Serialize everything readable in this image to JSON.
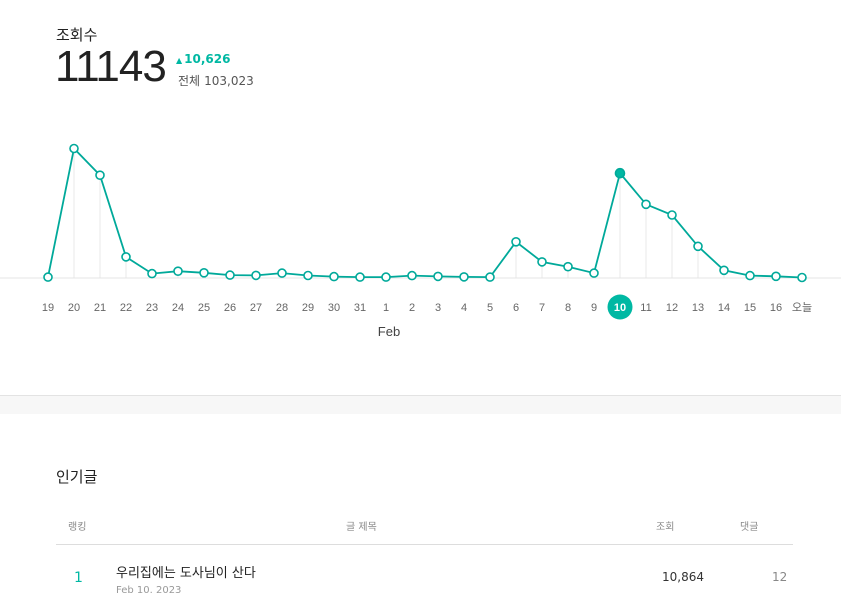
{
  "stats": {
    "label": "조회수",
    "value": "11143",
    "delta_arrow": "▲",
    "delta": "10,626",
    "total_label": "전체",
    "total": "103,023"
  },
  "chart_data": {
    "type": "line",
    "x": [
      "19",
      "20",
      "21",
      "22",
      "23",
      "24",
      "25",
      "26",
      "27",
      "28",
      "29",
      "30",
      "31",
      "1",
      "2",
      "3",
      "4",
      "5",
      "6",
      "7",
      "8",
      "9",
      "10",
      "11",
      "12",
      "13",
      "14",
      "15",
      "16",
      "오늘"
    ],
    "values": [
      95,
      12950,
      10280,
      2108,
      443,
      679,
      521,
      288,
      259,
      493,
      251,
      144,
      95,
      94,
      245,
      160,
      110,
      95,
      3617,
      1611,
      1126,
      493,
      10480,
      7367,
      6298,
      3166,
      765,
      244,
      170,
      51
    ],
    "highlight_label": "10",
    "month_label": "Feb",
    "ylim": [
      0,
      14000
    ],
    "grid": false,
    "accent_color": "#00b8a3"
  },
  "popular": {
    "title": "인기글",
    "headers": {
      "rank": "랭킹",
      "title": "글 제목",
      "views": "조회",
      "comments": "댓글"
    },
    "rows": [
      {
        "rank": "1",
        "title": "우리집에는 도사님이 산다",
        "date": "Feb 10. 2023",
        "views": "10,864",
        "comments": "12"
      }
    ]
  }
}
